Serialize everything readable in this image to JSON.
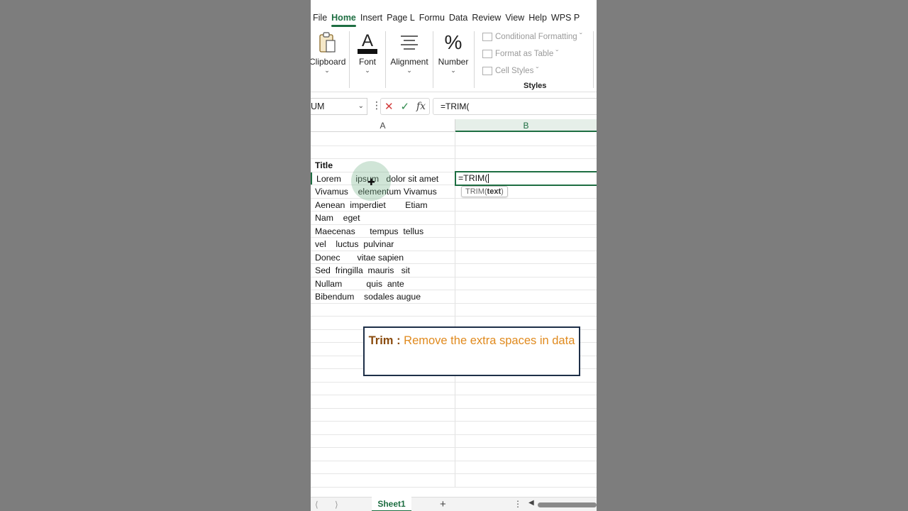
{
  "ribbon": {
    "tabs": [
      "File",
      "Home",
      "Insert",
      "Page L",
      "Formu",
      "Data",
      "Review",
      "View",
      "Help",
      "WPS P"
    ],
    "active_tab": "Home",
    "groups": {
      "clipboard": "Clipboard",
      "font": "Font",
      "alignment": "Alignment",
      "number": "Number"
    },
    "styles": {
      "conditional_formatting": "Conditional Formatting ˇ",
      "format_as_table": "Format as Table ˇ",
      "cell_styles": "Cell Styles ˇ",
      "group_label": "Styles"
    }
  },
  "formula_bar": {
    "name_box": "UM",
    "formula": "=TRIM("
  },
  "columns": [
    "A",
    "B"
  ],
  "rows": [
    {
      "a": "",
      "b": ""
    },
    {
      "a": "",
      "b": ""
    },
    {
      "a": "Title",
      "b": ""
    },
    {
      "a": "Lorem      ipsum   dolor sit amet",
      "b": ""
    },
    {
      "a": "Vivamus    elementum Vivamus",
      "b": ""
    },
    {
      "a": "Aenean  imperdiet        Etiam",
      "b": ""
    },
    {
      "a": "Nam    eget",
      "b": ""
    },
    {
      "a": "Maecenas      tempus  tellus",
      "b": ""
    },
    {
      "a": "vel    luctus  pulvinar",
      "b": ""
    },
    {
      "a": "Donec       vitae sapien",
      "b": ""
    },
    {
      "a": "Sed  fringilla  mauris   sit",
      "b": ""
    },
    {
      "a": "Nullam          quis  ante",
      "b": ""
    },
    {
      "a": "Bibendum    sodales augue",
      "b": ""
    }
  ],
  "active_cell": {
    "value": "=TRIM(",
    "tooltip_func": "TRIM(",
    "tooltip_arg": "text",
    "tooltip_close": ")"
  },
  "callout": {
    "keyword": "Trim",
    "separator": " : ",
    "text": "Remove the extra spaces in data"
  },
  "sheets": {
    "active": "Sheet1",
    "add_symbol": "+"
  },
  "colors": {
    "accent": "#1e6e42",
    "callout_text": "#e08a1e",
    "callout_keyword": "#8a4b0e",
    "callout_border": "#1e2f48"
  }
}
